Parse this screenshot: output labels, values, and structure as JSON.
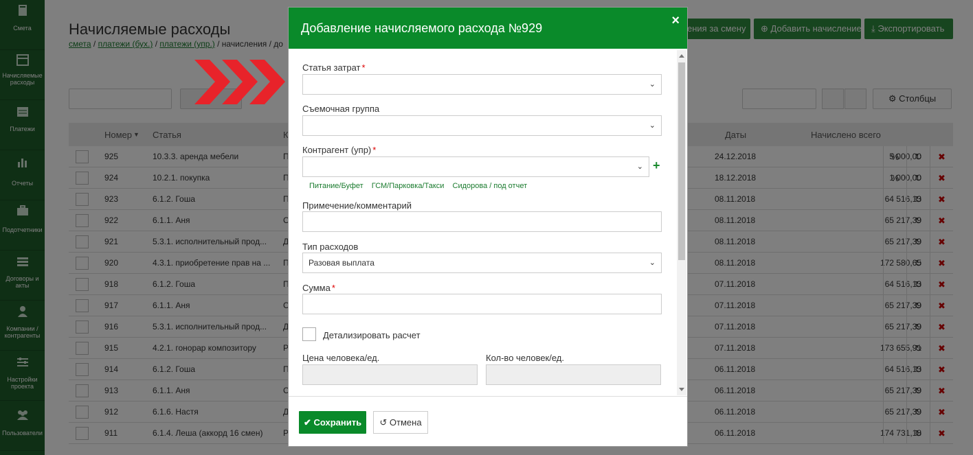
{
  "sidebar": {
    "items": [
      {
        "label": "Смета",
        "icon": "book-icon"
      },
      {
        "label": "Начисляемые расходы",
        "icon": "calendar-icon"
      },
      {
        "label": "Платежи",
        "icon": "list-icon"
      },
      {
        "label": "Отчеты",
        "icon": "bar-chart-icon"
      },
      {
        "label": "Подотчетники",
        "icon": "briefcase-icon"
      },
      {
        "label": "Договоры и акты",
        "icon": "list-lines-icon"
      },
      {
        "label": "Компании / контрагенты",
        "icon": "user-icon"
      },
      {
        "label": "Настройки проекта",
        "icon": "sliders-icon"
      },
      {
        "label": "Пользователи",
        "icon": "users-icon"
      }
    ]
  },
  "page": {
    "title": "Начисляемые расходы",
    "breadcrumb": {
      "l1": "смета",
      "l2": "платежи (бух.)",
      "l3": "платежи (упр.)",
      "current": "начисления / до"
    },
    "buttons": {
      "shift": "ения за смену",
      "add": "Добавить начисление",
      "export": "Экспортировать"
    },
    "columns_button": "Столбцы"
  },
  "table": {
    "headers": {
      "number": "Номер",
      "article": "Статья",
      "k": "К",
      "dates": "Даты",
      "total": "Начислено всего"
    },
    "rows": [
      {
        "num": "925",
        "article": "10.3.3. аренда мебели",
        "k": "П",
        "date": "24.12.2018",
        "amount": "5 000,00"
      },
      {
        "num": "924",
        "article": "10.2.1. покупка",
        "k": "П",
        "date": "18.12.2018",
        "amount": "1 000,00"
      },
      {
        "num": "923",
        "article": "6.1.2. Гоша",
        "k": "П",
        "date": "08.11.2018",
        "amount": "64 516,13"
      },
      {
        "num": "922",
        "article": "6.1.1. Аня",
        "k": "С",
        "date": "08.11.2018",
        "amount": "65 217,39"
      },
      {
        "num": "921",
        "article": "5.3.1. исполнительный прод...",
        "k": "Д",
        "date": "08.11.2018",
        "amount": "65 217,39"
      },
      {
        "num": "920",
        "article": "4.3.1. приобретение прав на ...",
        "k": "П",
        "date": "08.11.2018",
        "amount": "172 580,65"
      },
      {
        "num": "918",
        "article": "6.1.2. Гоша",
        "k": "П",
        "date": "07.11.2018",
        "amount": "64 516,13"
      },
      {
        "num": "917",
        "article": "6.1.1. Аня",
        "k": "С",
        "date": "07.11.2018",
        "amount": "65 217,39"
      },
      {
        "num": "916",
        "article": "5.3.1. исполнительный прод...",
        "k": "Д",
        "date": "07.11.2018",
        "amount": "65 217,39"
      },
      {
        "num": "915",
        "article": "4.2.1. гонорар композитору",
        "k": "Р",
        "date": "07.11.2018",
        "amount": "173 655,91"
      },
      {
        "num": "914",
        "article": "6.1.2. Гоша",
        "k": "П",
        "date": "06.11.2018",
        "amount": "64 516,13"
      },
      {
        "num": "913",
        "article": "6.1.1. Аня",
        "k": "С",
        "date": "06.11.2018",
        "amount": "65 217,39"
      },
      {
        "num": "912",
        "article": "6.1.6. Настя",
        "k": "Д",
        "date": "06.11.2018",
        "amount": "65 217,39"
      },
      {
        "num": "911",
        "article": "6.1.4. Леша (аккорд 16 смен)",
        "k": "Р",
        "date": "06.11.2018",
        "amount": "174 731,18"
      }
    ]
  },
  "modal": {
    "title": "Добавление начисляемого расхода №929",
    "close": "×",
    "fields": {
      "cost_item": {
        "label": "Статья затрат",
        "value": ""
      },
      "shooting_group": {
        "label": "Съемочная группа",
        "value": ""
      },
      "counterparty": {
        "label": "Контрагент (упр)",
        "value": ""
      },
      "quick_links": [
        "Питание/Буфет",
        "ГСМ/Парковка/Такси",
        "Сидорова / под отчет"
      ],
      "comment": {
        "label": "Примечение/комментарий",
        "value": ""
      },
      "expense_type": {
        "label": "Тип расходов",
        "value": "Разовая выплата"
      },
      "sum": {
        "label": "Сумма",
        "value": ""
      },
      "detail": {
        "label": "Детализировать расчет"
      },
      "price_per_person": {
        "label": "Цена человека/ед."
      },
      "persons_count": {
        "label": "Кол-во человек/ед."
      }
    },
    "save_label": "Сохранить",
    "cancel_label": "Отмена"
  },
  "colors": {
    "brand_green": "#0a8a2a",
    "sidebar_green": "#1f5e2a",
    "required_red": "#dd0000",
    "chevron_red": "#e8232a"
  }
}
